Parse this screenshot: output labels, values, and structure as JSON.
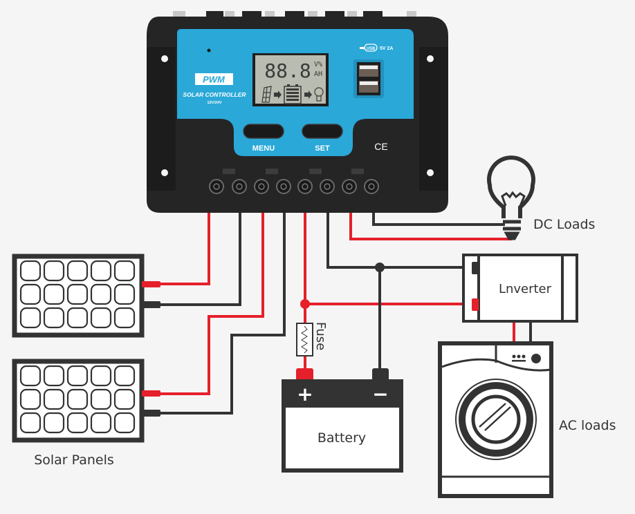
{
  "colors": {
    "background": "#f5f5f5",
    "wire_positive": "#e5202a",
    "wire_negative": "#333333",
    "controller_body": "#252525",
    "controller_face": "#2aa8d8",
    "lcd": "#b9bcb0"
  },
  "controller": {
    "badge": "PWM",
    "title": "SOLAR CONTROLLER",
    "voltage": "12V/24V",
    "lcd_digits": "88.8",
    "lcd_unit_top": "V%",
    "lcd_unit_bottom": "AH",
    "usb_label": "USB",
    "usb_rating": "5V 2A",
    "menu_label": "MENU",
    "set_label": "SET",
    "cert_mark": "CE",
    "terminal_count": 8
  },
  "components": {
    "solar_panels_label": "Solar Panels",
    "battery_label": "Battery",
    "battery_plus": "+",
    "battery_minus": "−",
    "fuse_label": "Fuse",
    "dc_loads_label": "DC Loads",
    "inverter_label": "Lnverter",
    "ac_loads_label": "AC loads"
  }
}
